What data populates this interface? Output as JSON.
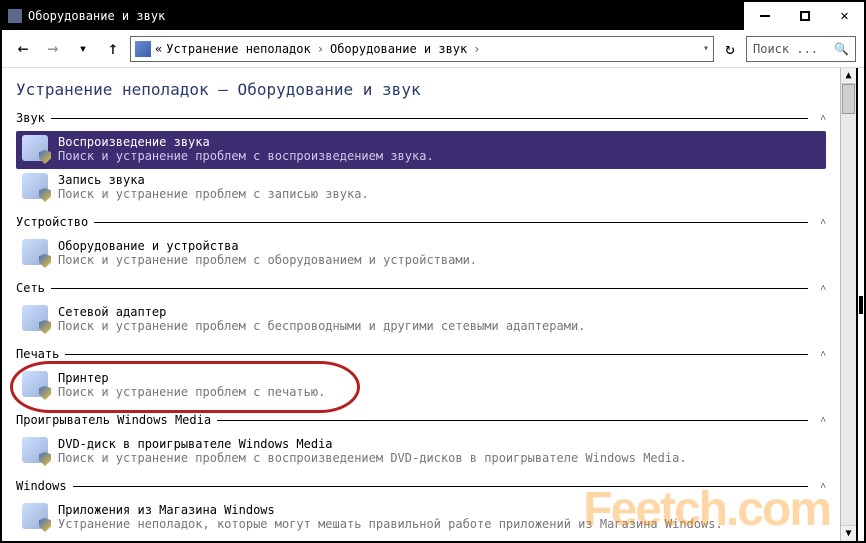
{
  "window": {
    "title": "Оборудование и звук"
  },
  "nav": {
    "crumb_prefix": "«",
    "crumb1": "Устранение неполадок",
    "crumb2": "Оборудование и звук",
    "search_placeholder": "Поиск ..."
  },
  "page": {
    "title": "Устранение неполадок — Оборудование и звук"
  },
  "groups": [
    {
      "label": "Звук",
      "items": [
        {
          "title": "Воспроизведение звука",
          "desc": "Поиск и устранение проблем с воспроизведением звука.",
          "selected": true
        },
        {
          "title": "Запись звука",
          "desc": "Поиск и устранение проблем с записью звука."
        }
      ]
    },
    {
      "label": "Устройство",
      "items": [
        {
          "title": "Оборудование и устройства",
          "desc": "Поиск и устранение проблем с оборудованием и устройствами."
        }
      ]
    },
    {
      "label": "Сеть",
      "items": [
        {
          "title": "Сетевой адаптер",
          "desc": "Поиск и устранение проблем с беспроводными и другими сетевыми адаптерами."
        }
      ]
    },
    {
      "label": "Печать",
      "items": [
        {
          "title": "Принтер",
          "desc": "Поиск и устранение проблем с печатью.",
          "highlight": true
        }
      ]
    },
    {
      "label": "Проигрыватель Windows Media",
      "items": [
        {
          "title": "DVD-диск в проигрывателе Windows Media",
          "desc": "Поиск и устранение проблем с воспроизведением DVD-дисков в проигрывателе Windows Media."
        }
      ]
    },
    {
      "label": "Windows",
      "items": [
        {
          "title": "Приложения из Магазина Windows",
          "desc": "Устранение неполадок, которые могут мешать правильной работе приложений из Магазина Windows."
        }
      ]
    }
  ],
  "watermark": "Feetch.com"
}
